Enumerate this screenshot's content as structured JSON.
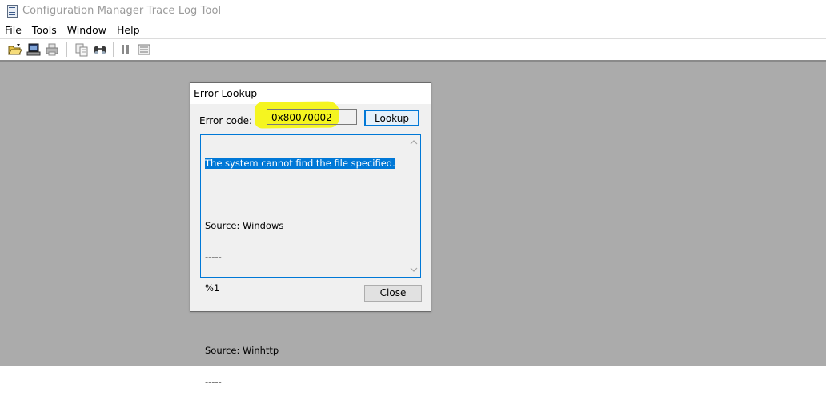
{
  "window": {
    "title": "Configuration Manager Trace Log Tool",
    "icon": "log-document-icon"
  },
  "menu": {
    "items": [
      "File",
      "Tools",
      "Window",
      "Help"
    ]
  },
  "toolbar": {
    "buttons": [
      "open-folder-icon",
      "computer-icon",
      "print-icon",
      "copy-icon",
      "find-icon",
      "pause-icon",
      "filter-list-icon"
    ]
  },
  "dialog": {
    "title": "Error Lookup",
    "error_code_label": "Error code:",
    "error_code_value": "0x80070002",
    "lookup_label": "Lookup",
    "close_label": "Close",
    "result_lines": [
      "The system cannot find the file specified.",
      "",
      "Source: Windows",
      "-----",
      "%1",
      "",
      "Source: Winhttp",
      "-----"
    ]
  },
  "colors": {
    "highlight": "#f5f520",
    "selection": "#0078d7",
    "workspace": "#ababab"
  }
}
